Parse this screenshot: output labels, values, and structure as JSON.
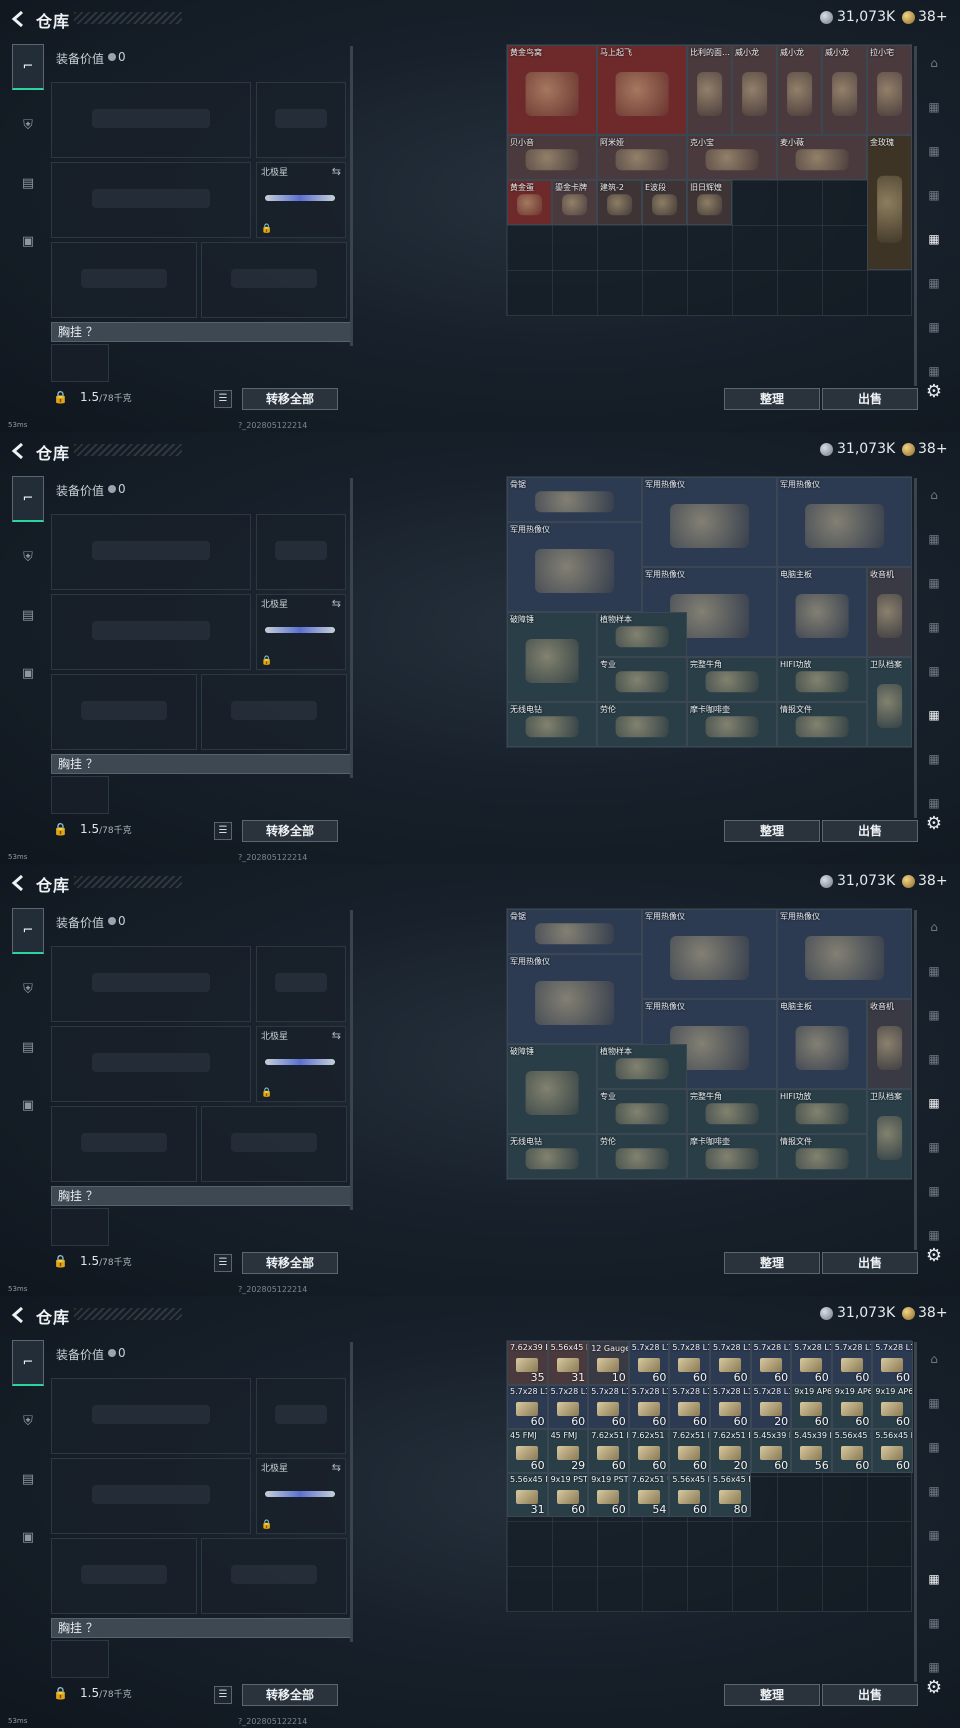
{
  "header": {
    "title": "仓库",
    "currency_main": "31,073K",
    "currency_secondary": "38+"
  },
  "gear": {
    "equip_value_label": "装备价值",
    "equip_value": "0",
    "slots": {
      "melee_label": "北极星"
    },
    "chest_label": "胸挂 ？",
    "weight": "1.5",
    "weight_max": "/78千克",
    "transfer_all": "转移全部"
  },
  "stash_buttons": {
    "sort": "整理",
    "sell": "出售"
  },
  "status": {
    "ping": "53ms",
    "build": "?_202805122214"
  },
  "frames": [
    {
      "name": "collectibles",
      "items": [
        {
          "label": "黄金鸟窝",
          "color": "#6e2a2a",
          "icon": "nest-icon"
        },
        {
          "label": "马上起飞",
          "color": "#6e2a2a",
          "icon": "horse-icon"
        },
        {
          "label": "比利的面…",
          "color": "#4a3a3e",
          "icon": "doll-icon"
        },
        {
          "label": "威小龙",
          "color": "#4a3a3e",
          "icon": "figure-icon"
        },
        {
          "label": "威小龙",
          "color": "#4a3a3e",
          "icon": "figure-icon"
        },
        {
          "label": "威小龙",
          "color": "#4a3a3e",
          "icon": "figure-icon"
        },
        {
          "label": "拉小宅",
          "color": "#4a3a3e",
          "icon": "figure-icon"
        },
        {
          "label": "贝小音",
          "color": "#4a3a3e",
          "icon": "figure-icon"
        },
        {
          "label": "阿米娅",
          "color": "#4a3a3e",
          "icon": "figure-icon"
        },
        {
          "label": "克小宝",
          "color": "#4a3a3e",
          "icon": "figure-icon"
        },
        {
          "label": "麦小薇",
          "color": "#4a3a3e",
          "icon": "figure-icon"
        },
        {
          "label": "金玫瑰",
          "color": "#3e3426",
          "icon": "rose-icon"
        },
        {
          "label": "黄金蛋",
          "color": "#6e2a2a",
          "icon": "egg-icon"
        },
        {
          "label": "鎏金卡牌",
          "color": "#4a3a3e",
          "icon": "card-icon"
        },
        {
          "label": "建筑-2",
          "color": "#3e3436",
          "icon": "card-icon"
        },
        {
          "label": "E波段",
          "color": "#3e3436",
          "icon": "card-icon"
        },
        {
          "label": "旧日辉煌",
          "color": "#3e3436",
          "icon": "card-icon"
        }
      ]
    },
    {
      "name": "equipment",
      "items": [
        {
          "label": "骨锯",
          "color": "#2c3a52",
          "icon": "saw-icon"
        },
        {
          "label": "军用热像仪",
          "color": "#2c3a52",
          "icon": "thermal-icon"
        },
        {
          "label": "军用热像仪",
          "color": "#2c3a52",
          "icon": "thermal-icon"
        },
        {
          "label": "军用热像仪",
          "color": "#2c3a52",
          "icon": "thermal-icon"
        },
        {
          "label": "军用热像仪",
          "color": "#2c3a52",
          "icon": "thermal-icon"
        },
        {
          "label": "电脑主板",
          "color": "#2c3a52",
          "icon": "board-icon"
        },
        {
          "label": "收音机",
          "color": "#3a3a44",
          "icon": "radio-icon"
        },
        {
          "label": "破障锤",
          "color": "#2a3e48",
          "icon": "hammer-icon"
        },
        {
          "label": "植物样本",
          "color": "#2a3e48",
          "icon": "sample-icon"
        },
        {
          "label": "专业",
          "color": "#2a3e48",
          "icon": "tool-icon"
        },
        {
          "label": "完整牛角",
          "color": "#2a3e48",
          "icon": "horn-icon"
        },
        {
          "label": "HIFI功放",
          "color": "#2a3e48",
          "icon": "amp-icon"
        },
        {
          "label": "卫队档案",
          "color": "#2a3e48",
          "icon": "file-icon"
        },
        {
          "label": "无线电钻",
          "color": "#2a3e48",
          "icon": "drill-icon"
        },
        {
          "label": "劳伦",
          "color": "#2a3e48",
          "icon": "roll-icon"
        },
        {
          "label": "摩卡咖啡壶",
          "color": "#2a3e48",
          "icon": "coffee-icon"
        },
        {
          "label": "情报文件",
          "color": "#2a3e48",
          "icon": "file-icon"
        }
      ]
    },
    {
      "name": "ammo",
      "items": [
        {
          "label": "7.62x39 BP",
          "count": "35",
          "color": "#4a3a3e"
        },
        {
          "label": "5.56x45 M855A1",
          "count": "31",
          "color": "#4a3a3e"
        },
        {
          "label": "12 Gauge 独头弹",
          "count": "10",
          "color": "#3a3a44"
        },
        {
          "label": "5.7x28 L191",
          "count": "60",
          "color": "#2c3a52"
        },
        {
          "label": "5.7x28 L191",
          "count": "60",
          "color": "#2c3a52"
        },
        {
          "label": "5.7x28 L191",
          "count": "60",
          "color": "#2c3a52"
        },
        {
          "label": "5.7x28 L191",
          "count": "60",
          "color": "#2c3a52"
        },
        {
          "label": "5.7x28 L191",
          "count": "60",
          "color": "#2c3a52"
        },
        {
          "label": "5.7x28 L191",
          "count": "60",
          "color": "#2c3a52"
        },
        {
          "label": "5.7x28 L191",
          "count": "60",
          "color": "#2c3a52"
        },
        {
          "label": "5.7x28 L191",
          "count": "60",
          "color": "#2c3a52"
        },
        {
          "label": "5.7x28 L191",
          "count": "60",
          "color": "#2c3a52"
        },
        {
          "label": "5.7x28 L191",
          "count": "60",
          "color": "#2c3a52"
        },
        {
          "label": "5.7x28 L191",
          "count": "60",
          "color": "#2c3a52"
        },
        {
          "label": "5.7x28 L191",
          "count": "60",
          "color": "#2c3a52"
        },
        {
          "label": "5.7x28 L191",
          "count": "60",
          "color": "#2c3a52"
        },
        {
          "label": "5.7x28 L191",
          "count": "20",
          "color": "#2c3a52"
        },
        {
          "label": "9x19 AP6.3",
          "count": "60",
          "color": "#2a3e48"
        },
        {
          "label": "9x19 AP6.3",
          "count": "60",
          "color": "#2a3e48"
        },
        {
          "label": "9x19 AP6.3",
          "count": "60",
          "color": "#2a3e48"
        },
        {
          "label": "45 FMJ",
          "count": "60",
          "color": "#2a3e48"
        },
        {
          "label": "45 FMJ",
          "count": "29",
          "color": "#2a3e48"
        },
        {
          "label": "7.62x51 BPZ",
          "count": "60",
          "color": "#2a3e48"
        },
        {
          "label": "7.62x51 BPZ",
          "count": "60",
          "color": "#2a3e48"
        },
        {
          "label": "7.62x51 BPZ",
          "count": "60",
          "color": "#2a3e48"
        },
        {
          "label": "7.62x51 BPZ",
          "count": "20",
          "color": "#2a3e48"
        },
        {
          "label": "5.45x39 PS",
          "count": "60",
          "color": "#2a3e48"
        },
        {
          "label": "5.45x39 PS",
          "count": "56",
          "color": "#2a3e48"
        },
        {
          "label": "5.56x45 M855",
          "count": "60",
          "color": "#2a3e48"
        },
        {
          "label": "5.56x45 M855",
          "count": "60",
          "color": "#2a3e48"
        },
        {
          "label": "5.56x45 M855",
          "count": "31",
          "color": "#2a3e48"
        },
        {
          "label": "9x19 PST",
          "count": "60",
          "color": "#2a3e48"
        },
        {
          "label": "9x19 PST",
          "count": "60",
          "color": "#2a3e48"
        },
        {
          "label": "7.62x51 UL",
          "count": "54",
          "color": "#2a3e48"
        },
        {
          "label": "5.56x45 FMJ",
          "count": "60",
          "color": "#2a3e48"
        },
        {
          "label": "5.56x45 FMJ",
          "count": "80",
          "color": "#2a3e48"
        }
      ]
    }
  ]
}
